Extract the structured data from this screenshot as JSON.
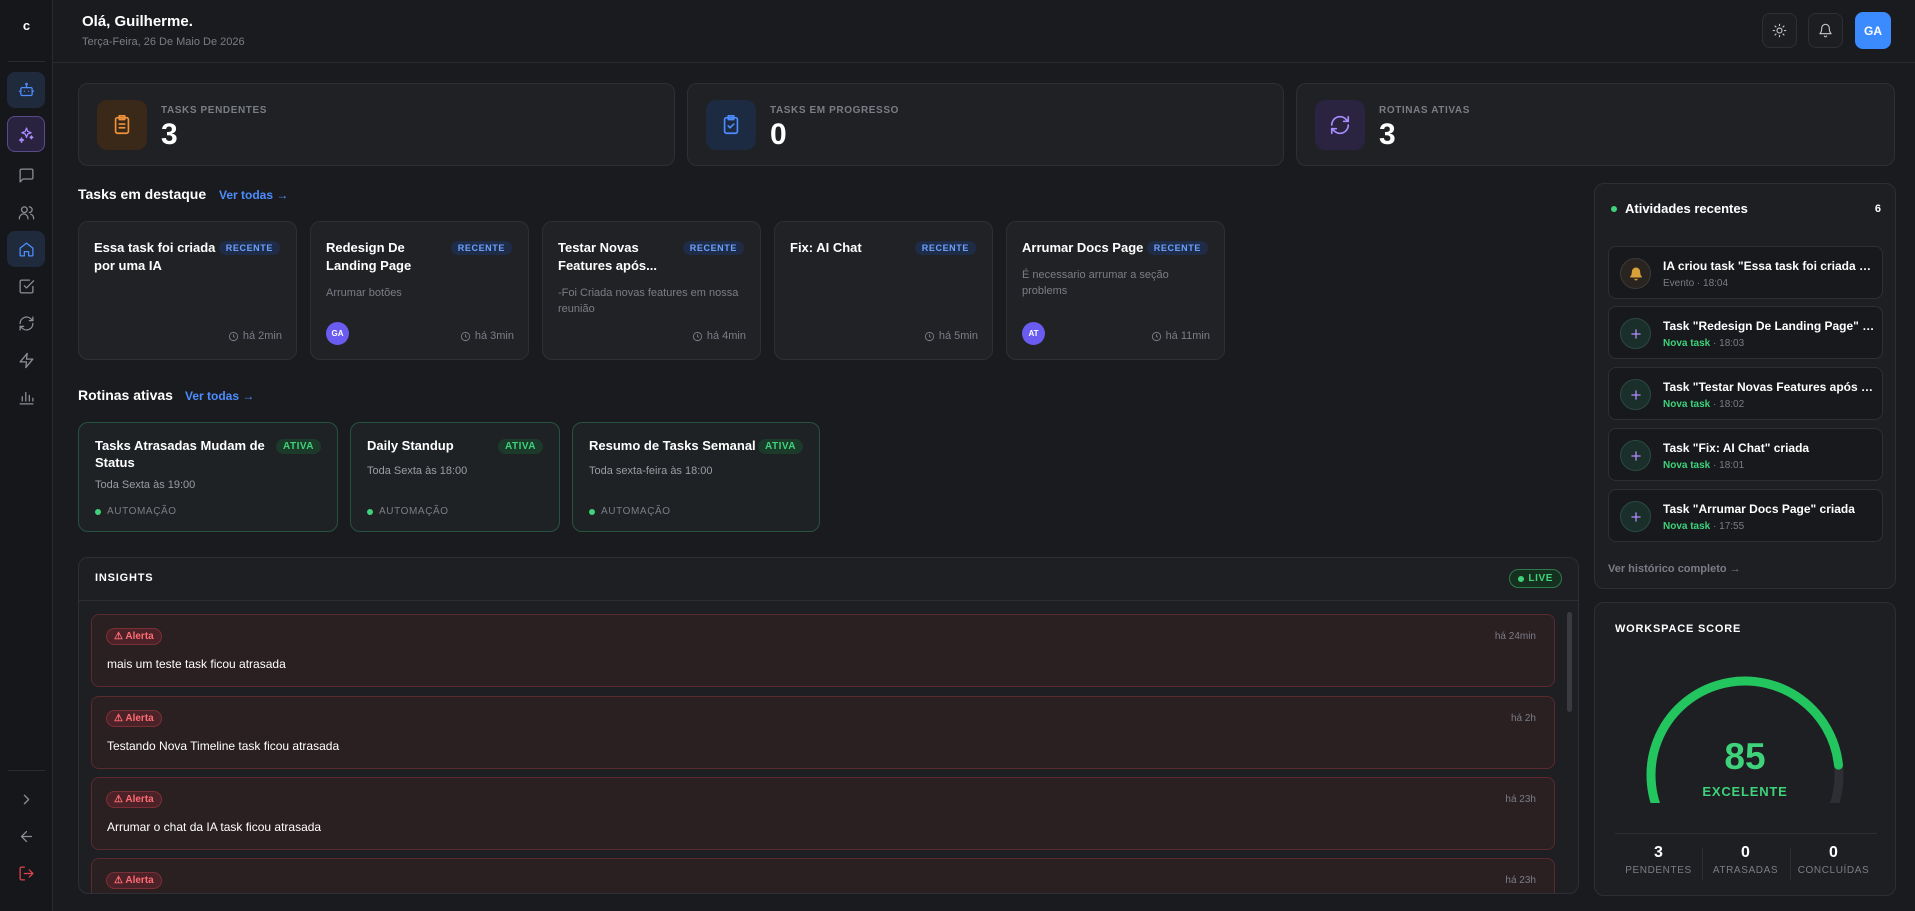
{
  "sidebar": {
    "logo": "c"
  },
  "header": {
    "greeting": "Olá, Guilherme.",
    "date": "Terça-Feira, 26 De Maio De 2026",
    "avatar": "GA"
  },
  "stats": [
    {
      "label": "TASKS PENDENTES",
      "value": "3"
    },
    {
      "label": "TASKS EM PROGRESSO",
      "value": "0"
    },
    {
      "label": "ROTINAS ATIVAS",
      "value": "3"
    }
  ],
  "featured": {
    "title": "Tasks em destaque",
    "link": "Ver todas →",
    "tasks": [
      {
        "title": "Essa task foi criada por uma IA",
        "badge": "RECENTE",
        "desc": "",
        "avatar": "",
        "time": "há 2min"
      },
      {
        "title": "Redesign De Landing Page",
        "badge": "RECENTE",
        "desc": "Arrumar botões",
        "avatar": "GA",
        "time": "há 3min"
      },
      {
        "title": "Testar Novas Features após...",
        "badge": "RECENTE",
        "desc": "-Foi Criada novas features em nossa reunião",
        "avatar": "",
        "time": "há 4min"
      },
      {
        "title": "Fix: AI Chat",
        "badge": "RECENTE",
        "desc": "",
        "avatar": "",
        "time": "há 5min"
      },
      {
        "title": "Arrumar Docs Page",
        "badge": "RECENTE",
        "desc": "É necessario arrumar a seção problems",
        "avatar": "AT",
        "time": "há 11min"
      }
    ]
  },
  "routines": {
    "title": "Rotinas ativas",
    "link": "Ver todas →",
    "items": [
      {
        "title": "Tasks Atrasadas Mudam de Status",
        "badge": "ATIVA",
        "schedule": "Toda Sexta às 19:00",
        "type": "AUTOMAÇÃO"
      },
      {
        "title": "Daily Standup",
        "badge": "ATIVA",
        "schedule": "Toda Sexta às 18:00",
        "type": "AUTOMAÇÃO"
      },
      {
        "title": "Resumo de Tasks Semanal",
        "badge": "ATIVA",
        "schedule": "Toda sexta-feira às 18:00",
        "type": "AUTOMAÇÃO"
      }
    ]
  },
  "insights": {
    "title": "INSIGHTS",
    "live": "LIVE",
    "alerts": [
      {
        "badge": "⚠ Alerta",
        "time": "há 24min",
        "text": "mais um teste task ficou atrasada"
      },
      {
        "badge": "⚠ Alerta",
        "time": "há 2h",
        "text": "Testando Nova Timeline task ficou atrasada"
      },
      {
        "badge": "⚠ Alerta",
        "time": "há 23h",
        "text": "Arrumar o chat da IA task ficou atrasada"
      },
      {
        "badge": "⚠ Alerta",
        "time": "há 23h",
        "text": ""
      }
    ]
  },
  "activity": {
    "title": "Atividades recentes",
    "count": "6",
    "items": [
      {
        "text": "IA criou task \"Essa task foi criada por uma IA\"",
        "kind": "Evento",
        "time": "18:04"
      },
      {
        "text": "Task \"Redesign De Landing Page\" criada",
        "kind": "Nova task",
        "time": "18:03"
      },
      {
        "text": "Task \"Testar Novas Features após reunião\" criada",
        "kind": "Nova task",
        "time": "18:02"
      },
      {
        "text": "Task \"Fix: AI Chat\" criada",
        "kind": "Nova task",
        "time": "18:01"
      },
      {
        "text": "Task \"Arrumar Docs Page\" criada",
        "kind": "Nova task",
        "time": "17:55"
      }
    ],
    "history_link": "Ver histórico completo →"
  },
  "score": {
    "title": "WORKSPACE SCORE",
    "value": 85,
    "max": 100,
    "label": "EXCELENTE",
    "color": "#22c55e",
    "stats": [
      {
        "value": "3",
        "label": "PENDENTES"
      },
      {
        "value": "0",
        "label": "ATRASADAS"
      },
      {
        "value": "0",
        "label": "CONCLUÍDAS"
      }
    ]
  }
}
